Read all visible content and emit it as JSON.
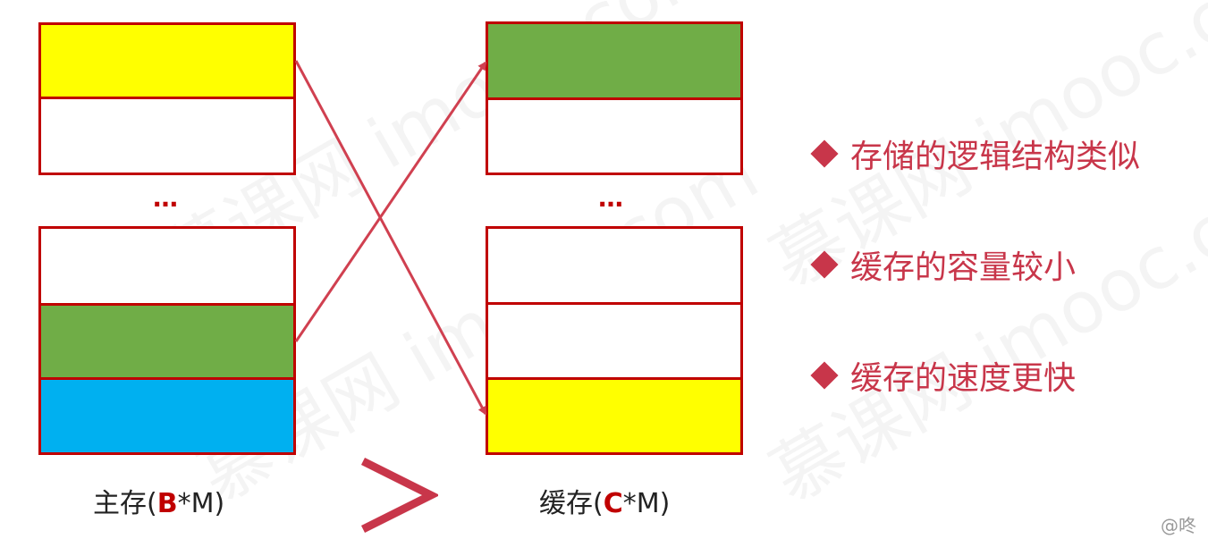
{
  "colors": {
    "border": "#c00000",
    "yellow": "#ffff00",
    "green": "#70ad47",
    "blue": "#00b0f0",
    "arrow": "#d04050",
    "bullet_text": "#c8364a"
  },
  "main_memory": {
    "ellipsis": "…",
    "caption_prefix": "主存(",
    "caption_var": "B",
    "caption_suffix": "*M)"
  },
  "cache": {
    "ellipsis": "…",
    "caption_prefix": "缓存(",
    "caption_var": "C",
    "caption_suffix": "*M)"
  },
  "comparison_symbol": ">",
  "bullets": [
    {
      "text": "存储的逻辑结构类似"
    },
    {
      "text": "缓存的容量较小"
    },
    {
      "text": "缓存的速度更快"
    }
  ],
  "watermark": {
    "text": "慕课网 imooc.com"
  },
  "footer_mark": "@咚"
}
